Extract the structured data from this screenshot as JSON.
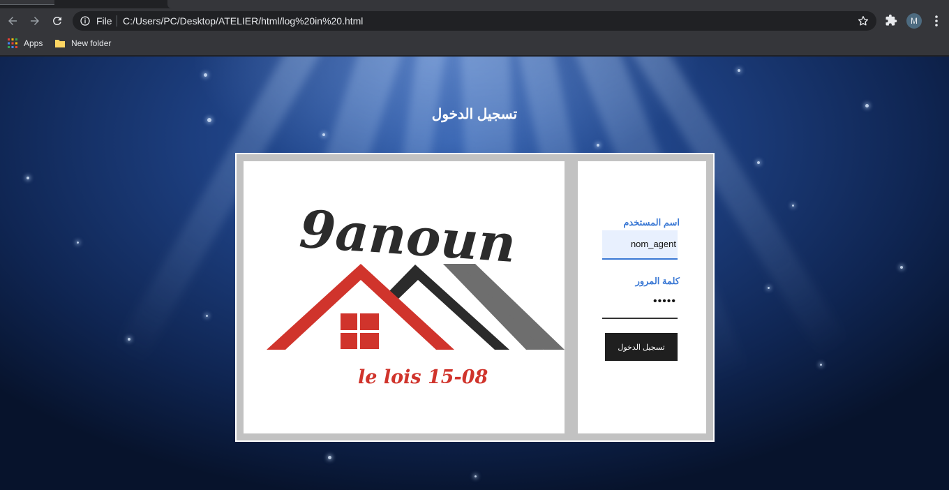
{
  "browser": {
    "scheme": "File",
    "url": "C:/Users/PC/Desktop/ATELIER/html/log%20in%20.html",
    "profile_initial": "M",
    "bookmarks": [
      {
        "label": "Apps",
        "icon": "apps-grid-icon"
      },
      {
        "label": "New folder",
        "icon": "folder-icon"
      }
    ]
  },
  "page": {
    "title": "تسجيل الدخول",
    "logo": {
      "wordmark": "9anoun",
      "tagline": "le lois 15-08"
    },
    "form": {
      "username_label": "اسم المستخدم",
      "username_value": "nom_agent",
      "password_label": "كلمة المرور",
      "password_value": "•••••",
      "submit_label": "تسجيل الدخول"
    }
  },
  "colors": {
    "accent_blue": "#3a78d4",
    "logo_red": "#d0342c",
    "logo_dark": "#2b2b2b",
    "logo_grey": "#6e6e6e",
    "button_dark": "#1f1f1f"
  }
}
